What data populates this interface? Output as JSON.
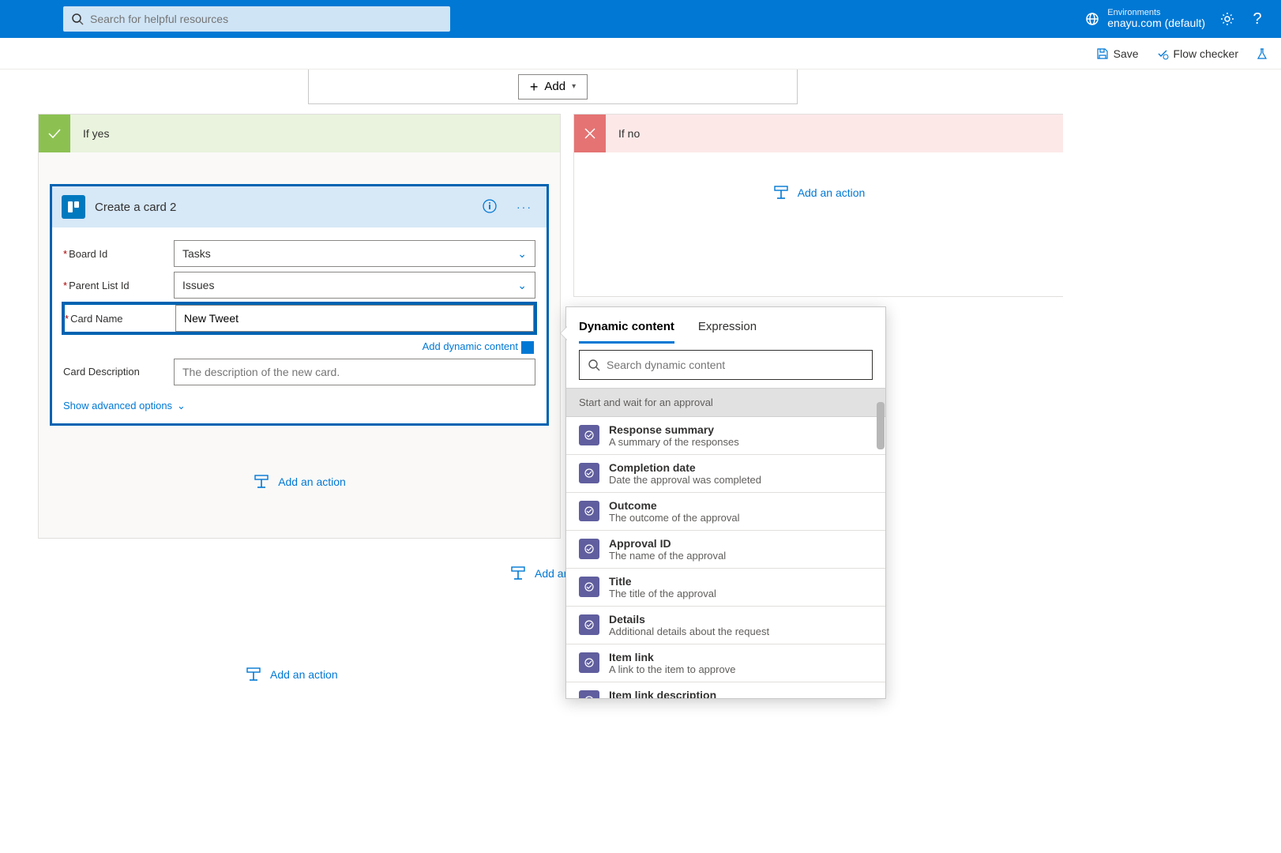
{
  "header": {
    "search_placeholder": "Search for helpful resources",
    "env_label": "Environments",
    "env_value": "enayu.com (default)"
  },
  "toolbar": {
    "save": "Save",
    "flow_checker": "Flow checker"
  },
  "top_action": {
    "add_label": "Add"
  },
  "branches": {
    "yes_label": "If yes",
    "no_label": "If no",
    "add_action": "Add an action"
  },
  "card": {
    "title": "Create a card 2",
    "fields": {
      "board_label": "Board Id",
      "board_value": "Tasks",
      "parent_label": "Parent List Id",
      "parent_value": "Issues",
      "name_label": "Card Name",
      "name_value": "New Tweet",
      "desc_label": "Card Description",
      "desc_placeholder": "The description of the new card."
    },
    "add_dynamic": "Add dynamic content",
    "advanced": "Show advanced options"
  },
  "flyout": {
    "tab_dynamic": "Dynamic content",
    "tab_expr": "Expression",
    "search_placeholder": "Search dynamic content",
    "section": "Start and wait for an approval",
    "items": [
      {
        "title": "Response summary",
        "desc": "A summary of the responses"
      },
      {
        "title": "Completion date",
        "desc": "Date the approval was completed"
      },
      {
        "title": "Outcome",
        "desc": "The outcome of the approval"
      },
      {
        "title": "Approval ID",
        "desc": "The name of the approval"
      },
      {
        "title": "Title",
        "desc": "The title of the approval"
      },
      {
        "title": "Details",
        "desc": "Additional details about the request"
      },
      {
        "title": "Item link",
        "desc": "A link to the item to approve"
      },
      {
        "title": "Item link description",
        "desc": ""
      }
    ]
  },
  "footer_links": {
    "add_an_action_mid": "Add an a",
    "add_an_action_btm": "Add an action"
  }
}
